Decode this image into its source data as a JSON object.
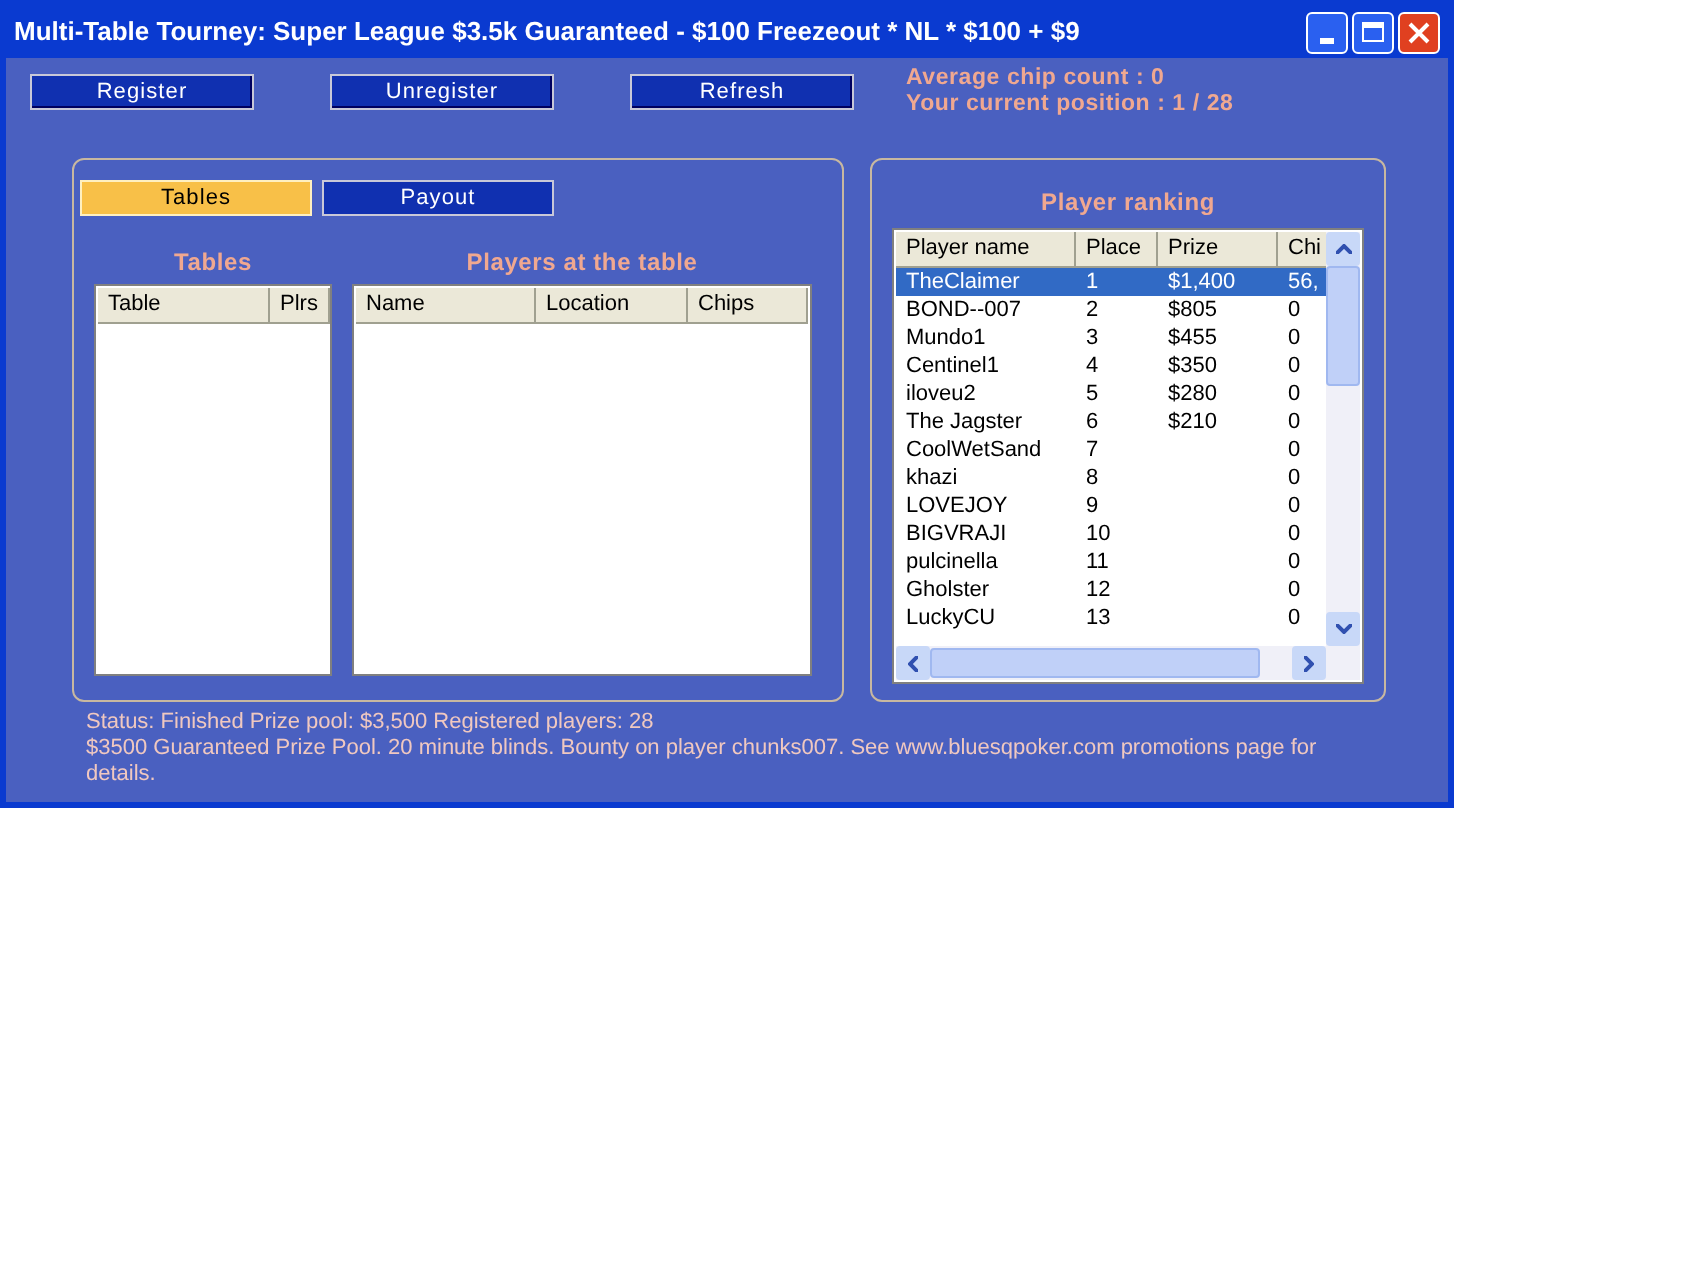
{
  "window": {
    "title": "Multi-Table Tourney: Super League $3.5k Guaranteed - $100 Freezeout * NL * $100 + $9"
  },
  "actions": [
    "Register",
    "Unregister",
    "Refresh"
  ],
  "info": [
    "Average chip count : 0",
    "Your current position : 1 / 28"
  ],
  "tabs": [
    {
      "label": "Tables",
      "selected": true
    },
    {
      "label": "Payout",
      "selected": false
    }
  ],
  "tables": {
    "title": "Tables",
    "columns": [
      "Table",
      "Plrs"
    ]
  },
  "players_at_table": {
    "title": "Players at the table",
    "columns": [
      "Name",
      "Location",
      "Chips"
    ]
  },
  "ranking": {
    "title": "Player ranking",
    "columns": [
      "Player name",
      "Place",
      "Prize",
      "Chi"
    ],
    "rows": [
      {
        "cells": [
          "TheClaimer",
          "1",
          "$1,400",
          "56,"
        ],
        "selected": true
      },
      {
        "cells": [
          "BOND--007",
          "2",
          "$805",
          "0"
        ],
        "selected": false
      },
      {
        "cells": [
          "Mundo1",
          "3",
          "$455",
          "0"
        ],
        "selected": false
      },
      {
        "cells": [
          "Centinel1",
          "4",
          "$350",
          "0"
        ],
        "selected": false
      },
      {
        "cells": [
          "iloveu2",
          "5",
          "$280",
          "0"
        ],
        "selected": false
      },
      {
        "cells": [
          "The Jagster",
          "6",
          "$210",
          "0"
        ],
        "selected": false
      },
      {
        "cells": [
          "CoolWetSand",
          "7",
          "",
          "0"
        ],
        "selected": false
      },
      {
        "cells": [
          "khazi",
          "8",
          "",
          "0"
        ],
        "selected": false
      },
      {
        "cells": [
          "LOVEJOY",
          "9",
          "",
          "0"
        ],
        "selected": false
      },
      {
        "cells": [
          "BIGVRAJI",
          "10",
          "",
          "0"
        ],
        "selected": false
      },
      {
        "cells": [
          "pulcinella",
          "11",
          "",
          "0"
        ],
        "selected": false
      },
      {
        "cells": [
          "Gholster",
          "12",
          "",
          "0"
        ],
        "selected": false
      },
      {
        "cells": [
          "LuckyCU",
          "13",
          "",
          "0"
        ],
        "selected": false
      }
    ]
  },
  "status": [
    "Status: Finished Prize pool: $3,500 Registered players: 28",
    "$3500 Guaranteed Prize Pool. 20 minute blinds.  Bounty on player chunks007.  See www.bluesqpoker.com promotions page for details."
  ]
}
